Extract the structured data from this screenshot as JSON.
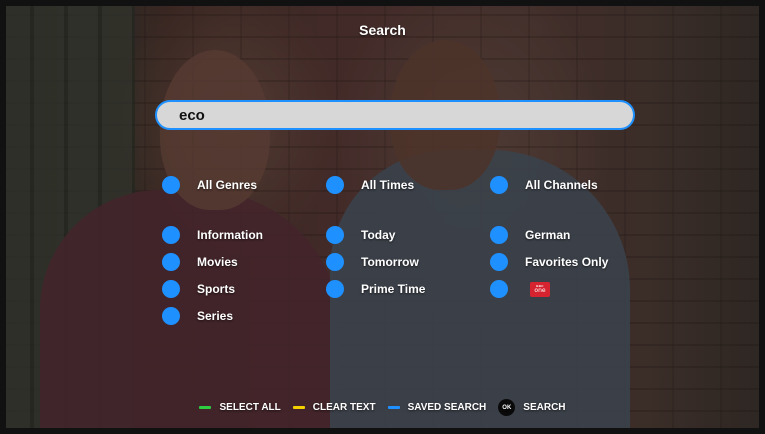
{
  "screen": {
    "title": "Search"
  },
  "search": {
    "value": "eco"
  },
  "colors": {
    "accent": "#1e90ff",
    "green": "#2ecc40",
    "yellow": "#f5d000",
    "blue": "#1e90ff"
  },
  "genres": {
    "all": "All Genres",
    "items": [
      "Information",
      "Movies",
      "Sports",
      "Series"
    ]
  },
  "times": {
    "all": "All Times",
    "items": [
      "Today",
      "Tomorrow",
      "Prime Time"
    ]
  },
  "channels": {
    "all": "All Channels",
    "items": [
      "German",
      "Favorites Only"
    ],
    "logo": {
      "line1": "BBC",
      "line2": "one",
      "icon": "bbc-one-logo"
    }
  },
  "footer": {
    "select_all": "SELECT ALL",
    "clear_text": "CLEAR TEXT",
    "saved_search": "SAVED SEARCH",
    "ok_key": "OK",
    "search": "SEARCH"
  }
}
